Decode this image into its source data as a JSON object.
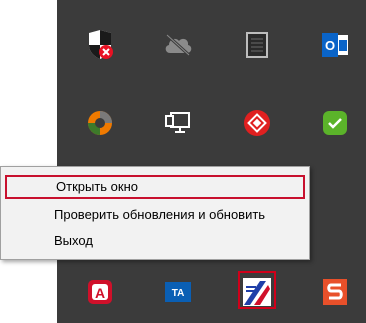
{
  "context_menu": {
    "items": [
      {
        "label": "Открыть окно"
      },
      {
        "label": "Проверить обновления и обновить"
      },
      {
        "label": "Выход"
      }
    ]
  },
  "tray": {
    "background": "#3b3b3b",
    "icons": [
      {
        "name": "security-shield-icon"
      },
      {
        "name": "cloud-offline-icon"
      },
      {
        "name": "tablet-grid-icon"
      },
      {
        "name": "outlook-icon"
      },
      {
        "name": "avast-orb-icon"
      },
      {
        "name": "network-monitor-icon"
      },
      {
        "name": "red-diamond-app-icon"
      },
      {
        "name": "green-check-icon"
      },
      {
        "name": "letter-a-app-icon"
      },
      {
        "name": "ta-app-icon"
      },
      {
        "name": "stripes-app-icon"
      },
      {
        "name": "letter-s-app-icon"
      }
    ]
  },
  "colors": {
    "highlight": "#c8102e",
    "menu_bg": "#f2f2f2"
  }
}
